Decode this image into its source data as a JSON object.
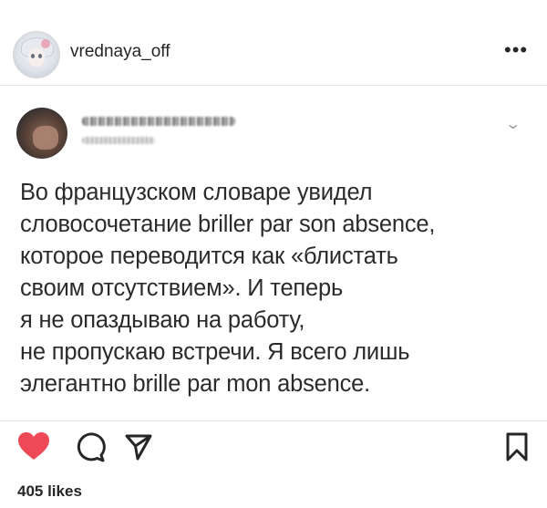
{
  "post": {
    "username": "vrednaya_off",
    "more_icon": "more-horizontal-icon",
    "likes": "405 likes"
  },
  "tweet": {
    "lines": [
      "Во французском словаре увидел",
      "словосочетание briller par son absence,",
      "которое переводится как «блистать",
      "своим отсутствием». И теперь",
      "я не опаздываю на работу,",
      "не пропускаю встречи. Я всего лишь",
      "элегантно brille par mon absence."
    ]
  },
  "colors": {
    "like": "#ed4956",
    "text": "#262626"
  },
  "icons": [
    "heart-icon",
    "comment-icon",
    "share-icon",
    "bookmark-icon",
    "chevron-down-icon"
  ]
}
